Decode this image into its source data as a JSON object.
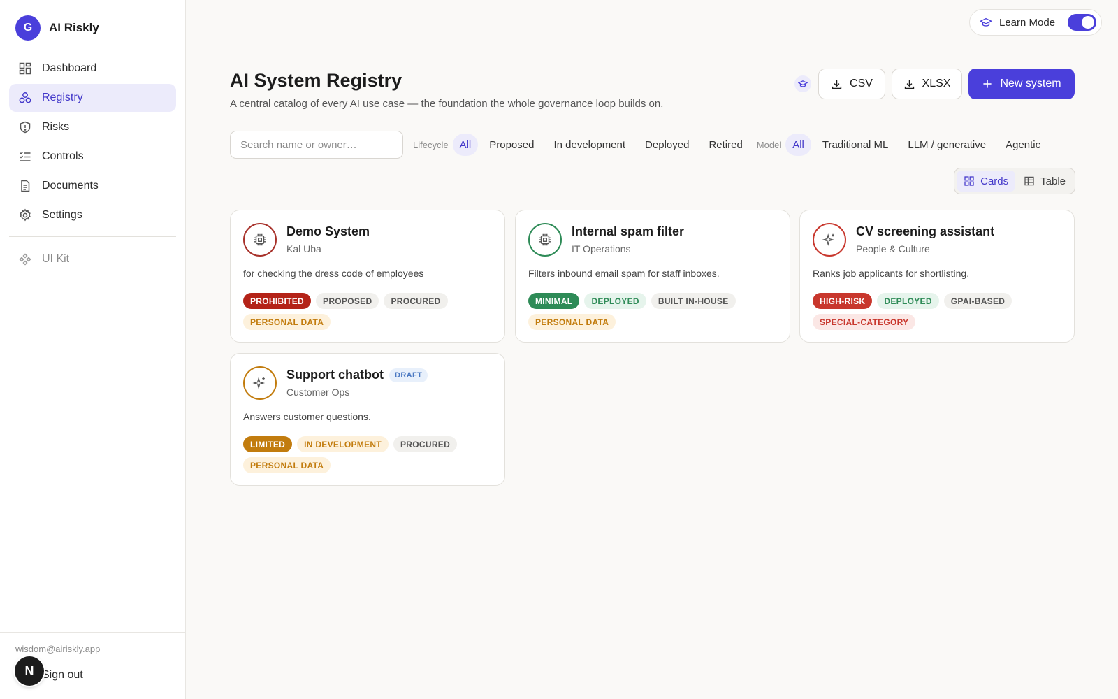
{
  "brand": {
    "initial": "G",
    "name": "AI Riskly"
  },
  "nav": {
    "items": [
      {
        "label": "Dashboard",
        "icon": "dashboard-icon"
      },
      {
        "label": "Registry",
        "icon": "registry-icon"
      },
      {
        "label": "Risks",
        "icon": "shield-icon"
      },
      {
        "label": "Controls",
        "icon": "checklist-icon"
      },
      {
        "label": "Documents",
        "icon": "document-icon"
      },
      {
        "label": "Settings",
        "icon": "gear-icon"
      }
    ],
    "secondary": {
      "label": "UI Kit",
      "icon": "component-icon"
    }
  },
  "user": {
    "email": "wisdom@airiskly.app",
    "signout": "Sign out",
    "badge": "N"
  },
  "topbar": {
    "learn_mode_label": "Learn Mode",
    "learn_mode_on": true
  },
  "page": {
    "title": "AI System Registry",
    "subtitle": "A central catalog of every AI use case — the foundation the whole governance loop builds on."
  },
  "actions": {
    "csv": "CSV",
    "xlsx": "XLSX",
    "new_system": "New system"
  },
  "search": {
    "placeholder": "Search name or owner…",
    "value": ""
  },
  "filters": {
    "lifecycle_label": "Lifecycle",
    "lifecycle": [
      "All",
      "Proposed",
      "In development",
      "Deployed",
      "Retired"
    ],
    "model_label": "Model",
    "model": [
      "All",
      "Traditional ML",
      "LLM / generative",
      "Agentic"
    ]
  },
  "view": {
    "cards": "Cards",
    "table": "Table",
    "selected": "Cards"
  },
  "colors": {
    "accent": "#4a3fdb",
    "prohibited": "#b42318",
    "minimal": "#2e8b57",
    "high_risk": "#c8372d",
    "limited": "#c27c0e"
  },
  "systems": [
    {
      "name": "Demo System",
      "owner": "Kal Uba",
      "description": "for checking the dress code of employees",
      "icon": "chip-icon",
      "draft": "",
      "tags": [
        "PROHIBITED",
        "PROPOSED",
        "PROCURED",
        "PERSONAL DATA"
      ]
    },
    {
      "name": "Internal spam filter",
      "owner": "IT Operations",
      "description": "Filters inbound email spam for staff inboxes.",
      "icon": "chip-icon",
      "draft": "",
      "tags": [
        "MINIMAL",
        "DEPLOYED",
        "BUILT IN-HOUSE",
        "PERSONAL DATA"
      ]
    },
    {
      "name": "CV screening assistant",
      "owner": "People & Culture",
      "description": "Ranks job applicants for shortlisting.",
      "icon": "sparkle-icon",
      "draft": "",
      "tags": [
        "HIGH-RISK",
        "DEPLOYED",
        "GPAI-BASED",
        "SPECIAL-CATEGORY"
      ]
    },
    {
      "name": "Support chatbot",
      "owner": "Customer Ops",
      "description": "Answers customer questions.",
      "icon": "sparkle-icon",
      "draft": "DRAFT",
      "tags": [
        "LIMITED",
        "IN DEVELOPMENT",
        "PROCURED",
        "PERSONAL DATA"
      ]
    }
  ]
}
